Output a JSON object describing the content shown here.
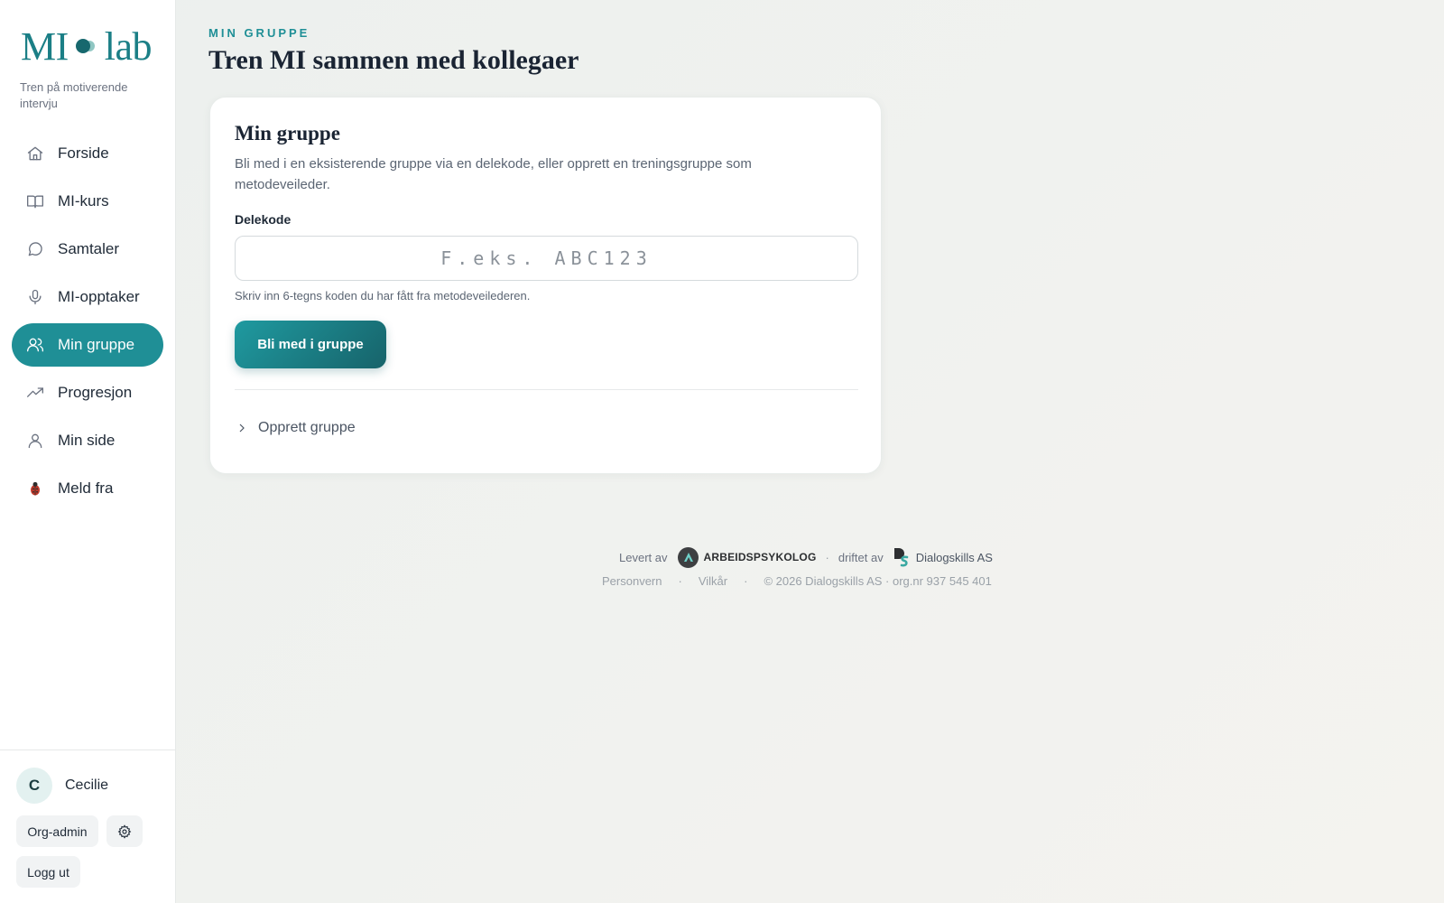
{
  "brand": {
    "logo_left": "MI",
    "logo_right": "lab",
    "tagline": "Tren på motiverende intervju"
  },
  "nav": {
    "items": [
      {
        "label": "Forside",
        "icon": "home-icon",
        "active": false
      },
      {
        "label": "MI-kurs",
        "icon": "book-icon",
        "active": false
      },
      {
        "label": "Samtaler",
        "icon": "chat-icon",
        "active": false
      },
      {
        "label": "MI-opptaker",
        "icon": "microphone-icon",
        "active": false
      },
      {
        "label": "Min gruppe",
        "icon": "users-icon",
        "active": true
      },
      {
        "label": "Progresjon",
        "icon": "trend-icon",
        "active": false
      },
      {
        "label": "Min side",
        "icon": "user-icon",
        "active": false
      },
      {
        "label": "Meld fra",
        "icon": "ladybug-icon",
        "active": false
      }
    ]
  },
  "user": {
    "initial": "C",
    "name": "Cecilie",
    "org_admin_label": "Org-admin",
    "logout_label": "Logg ut"
  },
  "header": {
    "eyebrow": "MIN GRUPPE",
    "title": "Tren MI sammen med kollegaer"
  },
  "card": {
    "title": "Min gruppe",
    "description": "Bli med i en eksisterende gruppe via en delekode, eller opprett en treningsgruppe som metodeveileder.",
    "field_label": "Delekode",
    "input_value": "",
    "input_placeholder": "F.eks. ABC123",
    "hint": "Skriv inn 6-tegns koden du har fått fra metodeveilederen.",
    "join_button": "Bli med i gruppe",
    "create_toggle": "Opprett gruppe"
  },
  "footer": {
    "delivered_by": "Levert av",
    "provider": "ARBEIDSPSYKOLOG",
    "operated_by": "driftet av",
    "operator": "Dialogskills AS",
    "privacy": "Personvern",
    "terms": "Vilkår",
    "copyright": "© 2026 Dialogskills AS · org.nr 937 545 401"
  },
  "colors": {
    "accent": "#1f8f96",
    "accent_dark": "#17636a",
    "text": "#1f2a37"
  }
}
